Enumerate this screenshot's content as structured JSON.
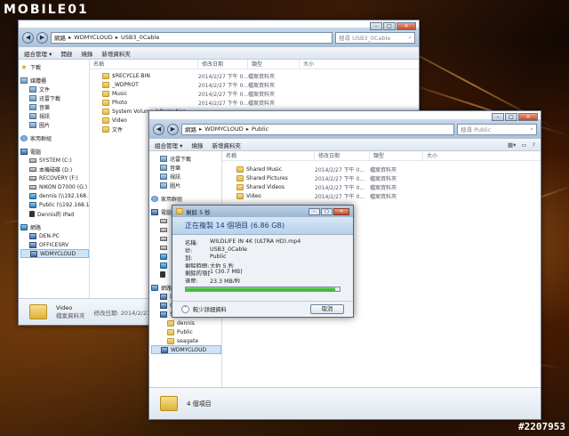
{
  "logo": "MOBILE01",
  "watermark": "#2207953",
  "back_window": {
    "address": [
      "網路",
      "WDMYCLOUD",
      "USB3_0Cable"
    ],
    "search_placeholder": "搜尋 USB3_0Cable",
    "toolbar": [
      "組合管理 ▾",
      "開啟",
      "燒錄",
      "新增資料夾"
    ],
    "columns": [
      "名稱",
      "修改日期",
      "類型",
      "大小"
    ],
    "nav": [
      {
        "label": "下載",
        "icon": "star",
        "type": "fav"
      },
      {
        "label": "媒體櫃",
        "icon": "lib",
        "type": "group"
      },
      {
        "label": "文件",
        "icon": "lib",
        "type": "sub"
      },
      {
        "label": "迅雷下載",
        "icon": "lib",
        "type": "sub"
      },
      {
        "label": "音樂",
        "icon": "lib",
        "type": "sub"
      },
      {
        "label": "視訊",
        "icon": "lib",
        "type": "sub"
      },
      {
        "label": "圖片",
        "icon": "lib",
        "type": "sub"
      },
      {
        "label": "家用群組",
        "icon": "group",
        "type": "group"
      },
      {
        "label": "電腦",
        "icon": "pc",
        "type": "group"
      },
      {
        "label": "SYSTEM (C:)",
        "icon": "drive",
        "type": "sub"
      },
      {
        "label": "本機磁碟 (D:)",
        "icon": "drive",
        "type": "sub"
      },
      {
        "label": "RECOVERY (F:)",
        "icon": "drive",
        "type": "sub"
      },
      {
        "label": "NIKON D7000 (G:)",
        "icon": "drive",
        "type": "sub"
      },
      {
        "label": "dennis (\\\\192.168.1",
        "icon": "net",
        "type": "sub"
      },
      {
        "label": "Public (\\\\192.168.1",
        "icon": "net",
        "type": "sub"
      },
      {
        "label": "Dennis的 iPad",
        "icon": "ipad",
        "type": "sub"
      },
      {
        "label": "網路",
        "icon": "net",
        "type": "group"
      },
      {
        "label": "DEN-PC",
        "icon": "pc",
        "type": "sub"
      },
      {
        "label": "OFFICESRV",
        "icon": "pc",
        "type": "sub"
      },
      {
        "label": "WDMYCLOUD",
        "icon": "pc",
        "type": "sub",
        "selected": true
      }
    ],
    "files": [
      {
        "name": "$RECYCLE.BIN",
        "date": "2014/2/27 下午 0...",
        "type": "檔案資料夾"
      },
      {
        "name": "_WDPROT",
        "date": "2014/2/27 下午 0...",
        "type": "檔案資料夾"
      },
      {
        "name": "Music",
        "date": "2014/2/27 下午 0...",
        "type": "檔案資料夾"
      },
      {
        "name": "Photo",
        "date": "2014/2/27 下午 0...",
        "type": "檔案資料夾"
      },
      {
        "name": "System Volume Information",
        "date": "",
        "type": ""
      },
      {
        "name": "Video",
        "date": "",
        "type": ""
      },
      {
        "name": "文件",
        "date": "",
        "type": ""
      }
    ],
    "details": {
      "name": "Video",
      "info": "修改日期: 2014/2/27 下午 09",
      "type": "檔案資料夾"
    }
  },
  "front_window": {
    "address": [
      "網路",
      "WDMYCLOUD",
      "Public"
    ],
    "search_placeholder": "搜尋 Public",
    "toolbar": [
      "組合管理 ▾",
      "燒錄",
      "新增資料夾"
    ],
    "columns": [
      "名稱",
      "修改日期",
      "類型",
      "大小"
    ],
    "nav": [
      {
        "label": "迅雷下載",
        "icon": "lib",
        "type": "sub"
      },
      {
        "label": "音樂",
        "icon": "lib",
        "type": "sub"
      },
      {
        "label": "視訊",
        "icon": "lib",
        "type": "sub"
      },
      {
        "label": "圖片",
        "icon": "lib",
        "type": "sub"
      },
      {
        "label": "家用群組",
        "icon": "group",
        "type": "group"
      },
      {
        "label": "電腦",
        "icon": "pc",
        "type": "group"
      },
      {
        "label": "",
        "icon": "drive",
        "type": "sub"
      },
      {
        "label": "",
        "icon": "drive",
        "type": "sub"
      },
      {
        "label": "",
        "icon": "drive",
        "type": "sub"
      },
      {
        "label": "",
        "icon": "drive",
        "type": "sub"
      },
      {
        "label": "",
        "icon": "net",
        "type": "sub"
      },
      {
        "label": "",
        "icon": "net",
        "type": "sub"
      },
      {
        "label": "",
        "icon": "ipad",
        "type": "sub"
      },
      {
        "label": "網路",
        "icon": "net",
        "type": "group"
      },
      {
        "label": "DEN-PC",
        "icon": "pc",
        "type": "sub"
      },
      {
        "label": "OFFICESRV",
        "icon": "pc",
        "type": "sub"
      },
      {
        "label": "Seagate-3EE4F1",
        "icon": "pc",
        "type": "sub"
      },
      {
        "label": "dennis",
        "icon": "folder",
        "type": "sub2"
      },
      {
        "label": "Public",
        "icon": "folder",
        "type": "sub2"
      },
      {
        "label": "seagate",
        "icon": "folder",
        "type": "sub2"
      },
      {
        "label": "WDMYCLOUD",
        "icon": "pc",
        "type": "sub",
        "selected": true
      }
    ],
    "files": [
      {
        "name": "Shared Music",
        "date": "2014/2/27 下午 0...",
        "type": "檔案資料夾"
      },
      {
        "name": "Shared Pictures",
        "date": "2014/2/27 下午 0...",
        "type": "檔案資料夾"
      },
      {
        "name": "Shared Videos",
        "date": "2014/2/27 下午 0...",
        "type": "檔案資料夾"
      },
      {
        "name": "Video",
        "date": "2014/2/27 下午 0...",
        "type": "檔案資料夾"
      }
    ],
    "details": {
      "count": "4 個項目"
    }
  },
  "copy_dialog": {
    "title": "剩餘 5 秒",
    "heading": "正在複製 14 個項目 (6.86 GB)",
    "rows": [
      {
        "label": "名稱:",
        "value": "WILDLIFE IN 4K (ULTRA HD).mp4"
      },
      {
        "label": "從:",
        "value": "USB3_0Cable"
      },
      {
        "label": "到:",
        "value": "Public"
      },
      {
        "label": "剩餘時間:",
        "value": "大約 5 秒"
      },
      {
        "label": "剩餘的項目:",
        "value": "1 (30.7 MB)"
      },
      {
        "label": "速度:",
        "value": "23.3 MB/秒"
      }
    ],
    "progress": 0.97,
    "less_info": "較少詳細資料",
    "cancel": "取消"
  }
}
